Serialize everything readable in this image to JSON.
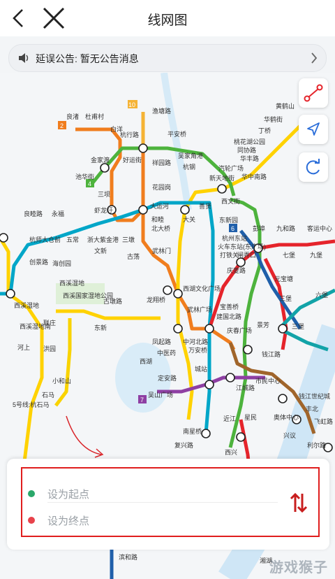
{
  "header": {
    "title": "线网图"
  },
  "notice": {
    "text": "延误公告: 暂无公告消息"
  },
  "route": {
    "start_placeholder": "设为起点",
    "end_placeholder": "设为终点"
  },
  "map_labels": {
    "l1": "良渚",
    "l2": "杜甫村",
    "l3": "白洋",
    "l4": "杭行路",
    "l5": "渔塘路",
    "l6": "平安桥",
    "l7": "华鹤街",
    "l8": "黄鹤山",
    "l9": "丁桥",
    "l10": "桃花湖公园",
    "l11": "金家渡",
    "l12": "好运街",
    "l13": "祥园路",
    "l14": "吴家角港",
    "l15": "同协路",
    "l16": "华丰路",
    "l17": "杭钢",
    "l18": "汽轮广场",
    "l19": "新天地街",
    "l20": "华中南路",
    "l21": "池华街",
    "l22": "三坝",
    "l23": "花园岗",
    "l24": "良睦路",
    "l25": "永福",
    "l26": "虾龙圩",
    "l27": "大运河",
    "l28": "西文街",
    "l29": "善贤",
    "l30": "和睦",
    "l31": "大关",
    "l32": "彭埠",
    "l33": "九和路",
    "l34": "客运中心",
    "l35": "杭师大仓前",
    "l36": "五常",
    "l37": "浙大紫金港",
    "l38": "三墩",
    "l39": "北大桥",
    "l40": "东新园",
    "l41": "火车东站(东广场)",
    "l42": "打铁关",
    "l43": "闸弄口",
    "l44": "七堡",
    "l45": "九堡",
    "l46": "创景路",
    "l47": "海创园",
    "l48": "文新",
    "l49": "古荡",
    "l50": "武林门",
    "l51": "武林广场",
    "l52": "西湖文化广场",
    "l53": "元宝塘",
    "l54": "景芳",
    "l55": "六堡",
    "l56": "西溪湿地",
    "l57": "西溪国家湿地公园",
    "l58": "古墩路",
    "l59": "龙翔桥",
    "l60": "庆春广场",
    "l61": "钱江路",
    "l62": "三堡",
    "l63": "联庄",
    "l64": "东新",
    "l65": "吴山广场",
    "l66": "凤起路",
    "l67": "城站",
    "l68": "江城路",
    "l69": "市民中心",
    "l70": "钱江世纪城",
    "l71": "西湖",
    "l72": "定安路",
    "l73": "近江",
    "l74": "星民",
    "l75": "奥体中心",
    "l76": "中河北路",
    "l77": "万安桥",
    "l78": "南星桥",
    "l79": "复兴路",
    "l80": "滨和路",
    "l81": "丰北",
    "l82": "飞虹路",
    "l83": "兴议",
    "l84": "利尔路",
    "l85": "湘湖",
    "l86": "洪园",
    "l87": "小和山",
    "l88": "石马",
    "l89": "西溪湿地南",
    "l90": "5号线:杭石马",
    "l91": "西溪湿地",
    "l92": "杭州东站",
    "l93": "庆菱路",
    "l94": "中医药",
    "l95": "宝善桥",
    "l96": "建国北路",
    "l97": "河上",
    "l98": "三堡",
    "l99": "西兴"
  },
  "line_badges": {
    "b2": "2",
    "b4": "4",
    "b6": "6",
    "b7": "7",
    "b10": "10"
  },
  "watermark": "游戏猴子",
  "colors": {
    "line1": "#e5242b",
    "line2": "#f07d1e",
    "line3": "#ffd200",
    "line4": "#4db33d",
    "line5": "#00a6c8",
    "line6": "#1f5faa",
    "line7": "#8e3fa3",
    "line8": "#12a3a8",
    "line10": "#f5b335",
    "line16": "#f9d300",
    "accent_red": "#e01e1e",
    "start_dot": "#2aa86a",
    "end_dot": "#e8424b"
  }
}
